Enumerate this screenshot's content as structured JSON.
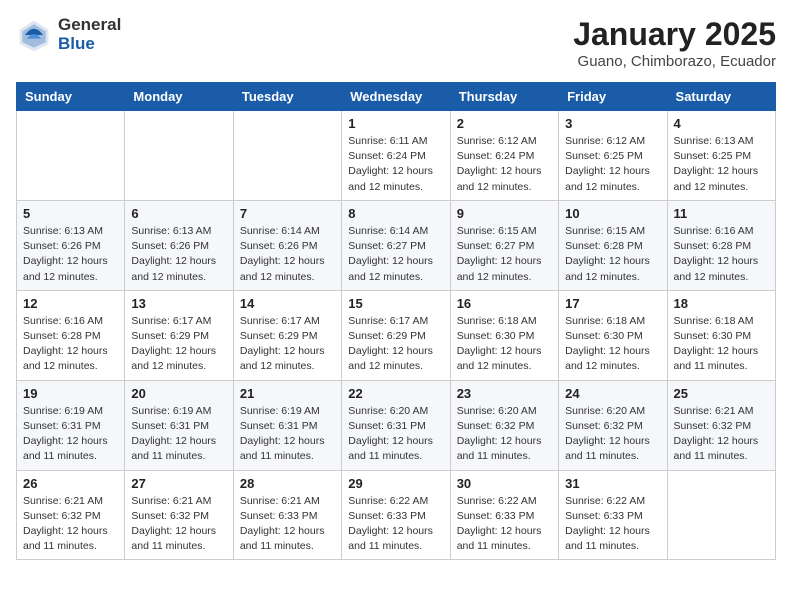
{
  "logo": {
    "general": "General",
    "blue": "Blue"
  },
  "header": {
    "month": "January 2025",
    "location": "Guano, Chimborazo, Ecuador"
  },
  "weekdays": [
    "Sunday",
    "Monday",
    "Tuesday",
    "Wednesday",
    "Thursday",
    "Friday",
    "Saturday"
  ],
  "weeks": [
    [
      {
        "day": "",
        "info": ""
      },
      {
        "day": "",
        "info": ""
      },
      {
        "day": "",
        "info": ""
      },
      {
        "day": "1",
        "info": "Sunrise: 6:11 AM\nSunset: 6:24 PM\nDaylight: 12 hours\nand 12 minutes."
      },
      {
        "day": "2",
        "info": "Sunrise: 6:12 AM\nSunset: 6:24 PM\nDaylight: 12 hours\nand 12 minutes."
      },
      {
        "day": "3",
        "info": "Sunrise: 6:12 AM\nSunset: 6:25 PM\nDaylight: 12 hours\nand 12 minutes."
      },
      {
        "day": "4",
        "info": "Sunrise: 6:13 AM\nSunset: 6:25 PM\nDaylight: 12 hours\nand 12 minutes."
      }
    ],
    [
      {
        "day": "5",
        "info": "Sunrise: 6:13 AM\nSunset: 6:26 PM\nDaylight: 12 hours\nand 12 minutes."
      },
      {
        "day": "6",
        "info": "Sunrise: 6:13 AM\nSunset: 6:26 PM\nDaylight: 12 hours\nand 12 minutes."
      },
      {
        "day": "7",
        "info": "Sunrise: 6:14 AM\nSunset: 6:26 PM\nDaylight: 12 hours\nand 12 minutes."
      },
      {
        "day": "8",
        "info": "Sunrise: 6:14 AM\nSunset: 6:27 PM\nDaylight: 12 hours\nand 12 minutes."
      },
      {
        "day": "9",
        "info": "Sunrise: 6:15 AM\nSunset: 6:27 PM\nDaylight: 12 hours\nand 12 minutes."
      },
      {
        "day": "10",
        "info": "Sunrise: 6:15 AM\nSunset: 6:28 PM\nDaylight: 12 hours\nand 12 minutes."
      },
      {
        "day": "11",
        "info": "Sunrise: 6:16 AM\nSunset: 6:28 PM\nDaylight: 12 hours\nand 12 minutes."
      }
    ],
    [
      {
        "day": "12",
        "info": "Sunrise: 6:16 AM\nSunset: 6:28 PM\nDaylight: 12 hours\nand 12 minutes."
      },
      {
        "day": "13",
        "info": "Sunrise: 6:17 AM\nSunset: 6:29 PM\nDaylight: 12 hours\nand 12 minutes."
      },
      {
        "day": "14",
        "info": "Sunrise: 6:17 AM\nSunset: 6:29 PM\nDaylight: 12 hours\nand 12 minutes."
      },
      {
        "day": "15",
        "info": "Sunrise: 6:17 AM\nSunset: 6:29 PM\nDaylight: 12 hours\nand 12 minutes."
      },
      {
        "day": "16",
        "info": "Sunrise: 6:18 AM\nSunset: 6:30 PM\nDaylight: 12 hours\nand 12 minutes."
      },
      {
        "day": "17",
        "info": "Sunrise: 6:18 AM\nSunset: 6:30 PM\nDaylight: 12 hours\nand 12 minutes."
      },
      {
        "day": "18",
        "info": "Sunrise: 6:18 AM\nSunset: 6:30 PM\nDaylight: 12 hours\nand 11 minutes."
      }
    ],
    [
      {
        "day": "19",
        "info": "Sunrise: 6:19 AM\nSunset: 6:31 PM\nDaylight: 12 hours\nand 11 minutes."
      },
      {
        "day": "20",
        "info": "Sunrise: 6:19 AM\nSunset: 6:31 PM\nDaylight: 12 hours\nand 11 minutes."
      },
      {
        "day": "21",
        "info": "Sunrise: 6:19 AM\nSunset: 6:31 PM\nDaylight: 12 hours\nand 11 minutes."
      },
      {
        "day": "22",
        "info": "Sunrise: 6:20 AM\nSunset: 6:31 PM\nDaylight: 12 hours\nand 11 minutes."
      },
      {
        "day": "23",
        "info": "Sunrise: 6:20 AM\nSunset: 6:32 PM\nDaylight: 12 hours\nand 11 minutes."
      },
      {
        "day": "24",
        "info": "Sunrise: 6:20 AM\nSunset: 6:32 PM\nDaylight: 12 hours\nand 11 minutes."
      },
      {
        "day": "25",
        "info": "Sunrise: 6:21 AM\nSunset: 6:32 PM\nDaylight: 12 hours\nand 11 minutes."
      }
    ],
    [
      {
        "day": "26",
        "info": "Sunrise: 6:21 AM\nSunset: 6:32 PM\nDaylight: 12 hours\nand 11 minutes."
      },
      {
        "day": "27",
        "info": "Sunrise: 6:21 AM\nSunset: 6:32 PM\nDaylight: 12 hours\nand 11 minutes."
      },
      {
        "day": "28",
        "info": "Sunrise: 6:21 AM\nSunset: 6:33 PM\nDaylight: 12 hours\nand 11 minutes."
      },
      {
        "day": "29",
        "info": "Sunrise: 6:22 AM\nSunset: 6:33 PM\nDaylight: 12 hours\nand 11 minutes."
      },
      {
        "day": "30",
        "info": "Sunrise: 6:22 AM\nSunset: 6:33 PM\nDaylight: 12 hours\nand 11 minutes."
      },
      {
        "day": "31",
        "info": "Sunrise: 6:22 AM\nSunset: 6:33 PM\nDaylight: 12 hours\nand 11 minutes."
      },
      {
        "day": "",
        "info": ""
      }
    ]
  ]
}
